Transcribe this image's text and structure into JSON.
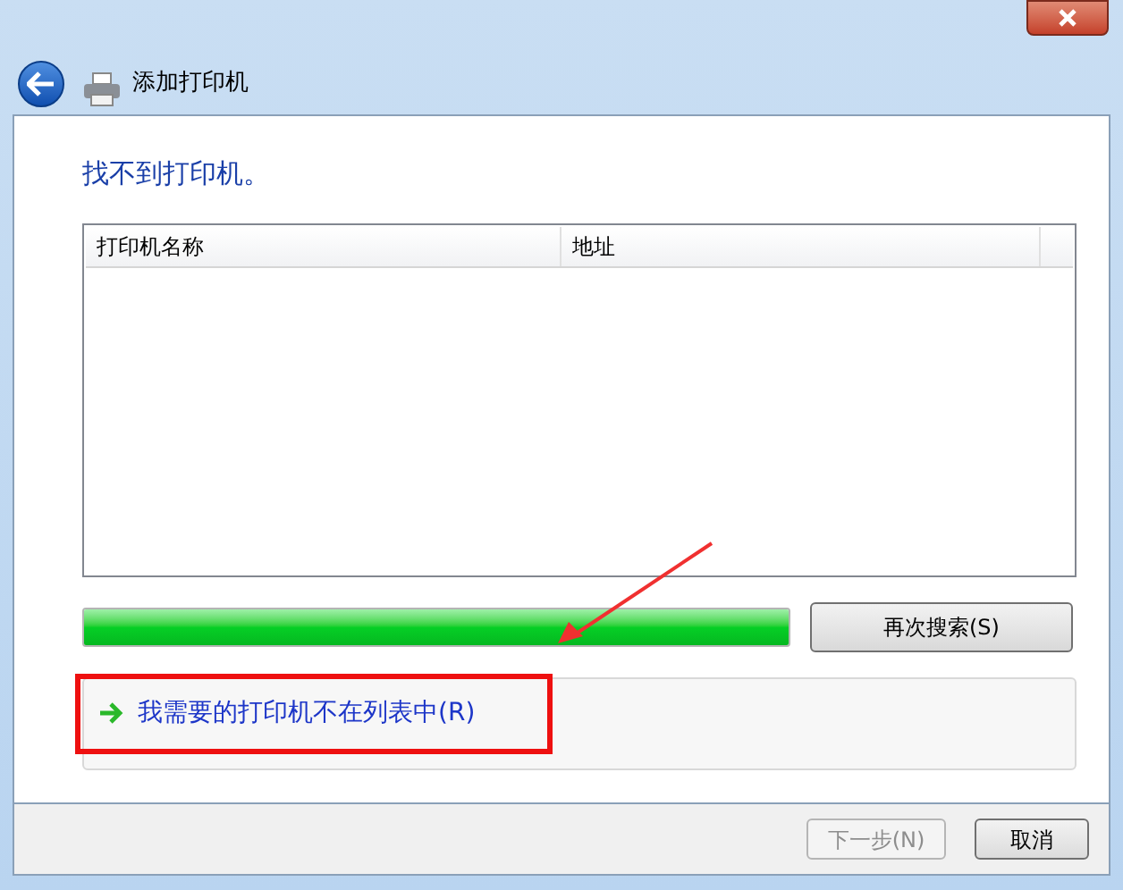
{
  "window": {
    "title": "添加打印机"
  },
  "heading": "找不到打印机。",
  "table": {
    "columns": [
      "打印机名称",
      "地址"
    ]
  },
  "progress": {
    "level": 1
  },
  "search_again_button": "再次搜索(S)",
  "link": "我需要的打印机不在列表中(R)",
  "buttons": [
    {
      "label": "下一步(N)",
      "disabled": true
    },
    {
      "label": "取消",
      "disabled": false
    }
  ]
}
